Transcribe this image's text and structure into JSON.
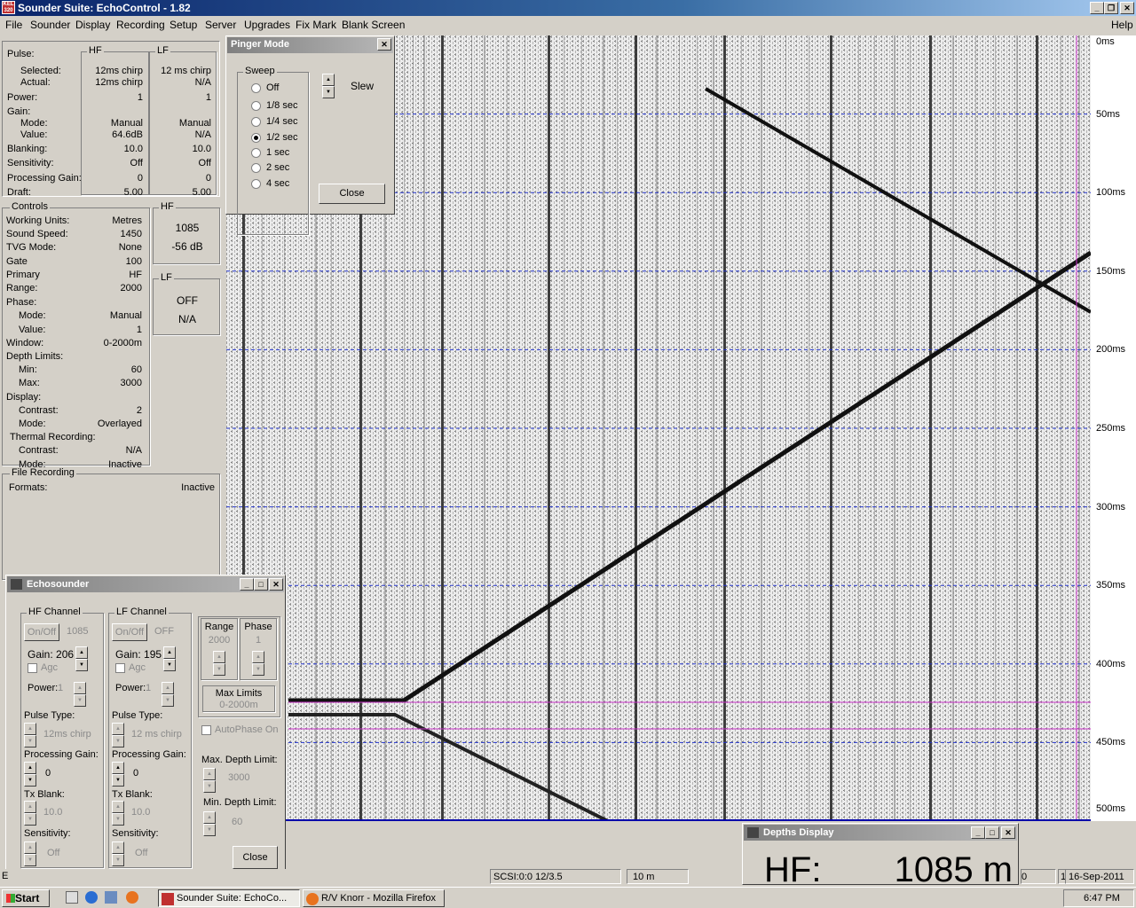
{
  "window": {
    "title": "Sounder Suite: EchoControl - 1.82",
    "icon_text": "KEL 320"
  },
  "menu": [
    "File",
    "Sounder",
    "Display",
    "Recording",
    "Setup",
    "Server",
    "Upgrades",
    "Fix Mark",
    "Blank Screen"
  ],
  "help": "Help",
  "pulse": {
    "title": "Pulse:",
    "hf": "HF",
    "lf": "LF",
    "rows": [
      {
        "label": "Selected:",
        "hf": "12ms chirp",
        "lf": "12 ms chirp"
      },
      {
        "label": "Actual:",
        "hf": "12ms chirp",
        "lf": "N/A"
      },
      {
        "label": "Power:",
        "hf": "1",
        "lf": "1"
      },
      {
        "label": "Gain:",
        "hf": "",
        "lf": ""
      },
      {
        "label": "Mode:",
        "hf": "Manual",
        "lf": "Manual"
      },
      {
        "label": "Value:",
        "hf": "64.6dB",
        "lf": "N/A"
      },
      {
        "label": "Blanking:",
        "hf": "10.0",
        "lf": "10.0"
      },
      {
        "label": "Sensitivity:",
        "hf": "Off",
        "lf": "Off"
      },
      {
        "label": "Processing Gain:",
        "hf": "0",
        "lf": "0"
      },
      {
        "label": "Draft:",
        "hf": "5.00",
        "lf": "5.00"
      }
    ]
  },
  "controls": {
    "title": "Controls",
    "rows": [
      {
        "label": "Working Units:",
        "value": "Metres"
      },
      {
        "label": "Sound Speed:",
        "value": "1450"
      },
      {
        "label": "TVG Mode:",
        "value": "None"
      },
      {
        "label": "Gate",
        "value": "100"
      },
      {
        "label": "Primary",
        "value": "HF"
      },
      {
        "label": "Range:",
        "value": "2000"
      },
      {
        "label": "Phase:",
        "value": ""
      },
      {
        "label": "Mode:",
        "value": "Manual"
      },
      {
        "label": "Value:",
        "value": "1"
      },
      {
        "label": "Window:",
        "value": "0-2000m"
      },
      {
        "label": "Depth Limits:",
        "value": ""
      },
      {
        "label": "Min:",
        "value": "60"
      },
      {
        "label": "Max:",
        "value": "3000"
      },
      {
        "label": "Display:",
        "value": ""
      },
      {
        "label": "Contrast:",
        "value": "2"
      },
      {
        "label": "Mode:",
        "value": "Overlayed"
      },
      {
        "label": "Thermal Recording:",
        "value": ""
      },
      {
        "label": "Contrast:",
        "value": "N/A"
      },
      {
        "label": "Mode:",
        "value": "Inactive"
      }
    ]
  },
  "hfbox": {
    "title": "HF",
    "depth": "1085",
    "level": "-56 dB"
  },
  "lfbox": {
    "title": "LF",
    "depth": "OFF",
    "level": "N/A"
  },
  "filerec": {
    "title": "File Recording",
    "label": "Formats:",
    "value": "Inactive"
  },
  "pinger": {
    "title": "Pinger Mode",
    "group": "Sweep",
    "options": [
      "Off",
      "1/8 sec",
      "1/4 sec",
      "1/2 sec",
      "1 sec",
      "2 sec",
      "4 sec"
    ],
    "selected": 3,
    "slew": "Slew",
    "close": "Close"
  },
  "depth_scale": [
    "0ms",
    "50ms",
    "100ms",
    "150ms",
    "200ms",
    "250ms",
    "300ms",
    "350ms",
    "400ms",
    "450ms",
    "500ms"
  ],
  "echosounder": {
    "title": "Echosounder",
    "hf": {
      "group": "HF Channel",
      "onoff": "On/Off",
      "value": "1085",
      "gain": "Gain: 206",
      "agc": "Agc",
      "power": "Power:",
      "power_val": "1",
      "pulse_type": "Pulse Type:",
      "pulse_val": "12ms chirp",
      "proc_gain": "Processing Gain:",
      "proc_val": "0",
      "tx_blank": "Tx Blank:",
      "tx_val": "10.0",
      "sens": "Sensitivity:",
      "sens_val": "Off"
    },
    "lf": {
      "group": "LF Channel",
      "onoff": "On/Off",
      "value": "OFF",
      "gain": "Gain: 195",
      "agc": "Agc",
      "power": "Power:",
      "power_val": "1",
      "pulse_type": "Pulse Type:",
      "pulse_val": "12 ms chirp",
      "proc_gain": "Processing Gain:",
      "proc_val": "0",
      "tx_blank": "Tx Blank:",
      "tx_val": "10.0",
      "sens": "Sensitivity:",
      "sens_val": "Off"
    },
    "range": "Range",
    "range_val": "2000",
    "phase": "Phase",
    "phase_val": "1",
    "maxlim": "Max Limits",
    "maxlim_val": "0-2000m",
    "autophase": "AutoPhase On",
    "maxdepth": "Max. Depth Limit:",
    "maxdepth_val": "3000",
    "mindepth": "Min. Depth Limit:",
    "mindepth_val": "60",
    "close": "Close"
  },
  "depths_display": {
    "title": "Depths Display",
    "label": "HF:",
    "value": "1085 m"
  },
  "status": {
    "scsi": "SCSI:0:0  12/3.5",
    "scale": "10 m",
    "left": "E",
    "mid": "0",
    "time": "18:47",
    "date": "16-Sep-2011"
  },
  "taskbar": {
    "start": "Start",
    "tasks": [
      "Sounder Suite: EchoCo...",
      "R/V Knorr - Mozilla Firefox"
    ],
    "clock": "6:47 PM"
  }
}
